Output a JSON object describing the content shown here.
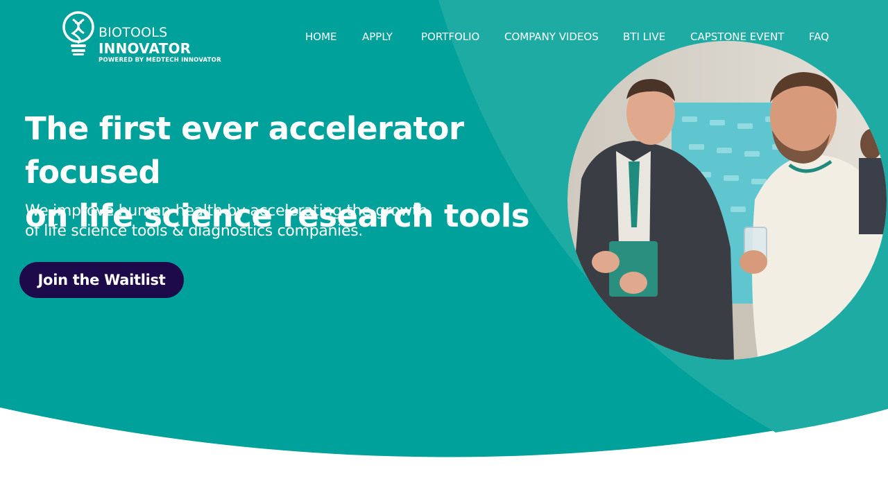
{
  "brand": {
    "line1": "BIOTOOLS",
    "line2": "INNOVATOR",
    "powered_by": "POWERED BY MEDTECH INNOVATOR",
    "logo_icon": "lightbulb-dna-icon"
  },
  "nav": {
    "items": [
      {
        "label": "HOME"
      },
      {
        "label": "APPLY"
      },
      {
        "label": "PORTFOLIO"
      },
      {
        "label": "COMPANY VIDEOS"
      },
      {
        "label": "BTI LIVE"
      },
      {
        "label": "CAPSTONE EVENT"
      },
      {
        "label": "FAQ"
      }
    ]
  },
  "hero": {
    "headline_line1": "The first ever accelerator focused",
    "headline_line2": "on life science research tools",
    "subhead_line1": "We improve human health by accelerating the growth",
    "subhead_line2": "of life science tools & diagnostics companies.",
    "cta_label": "Join the Waitlist",
    "photo_icon": "two-men-networking-photo"
  },
  "colors": {
    "teal": "#00a19a",
    "teal_light": "#1eaba4",
    "button": "#1d0a4a",
    "text": "#ffffff"
  }
}
